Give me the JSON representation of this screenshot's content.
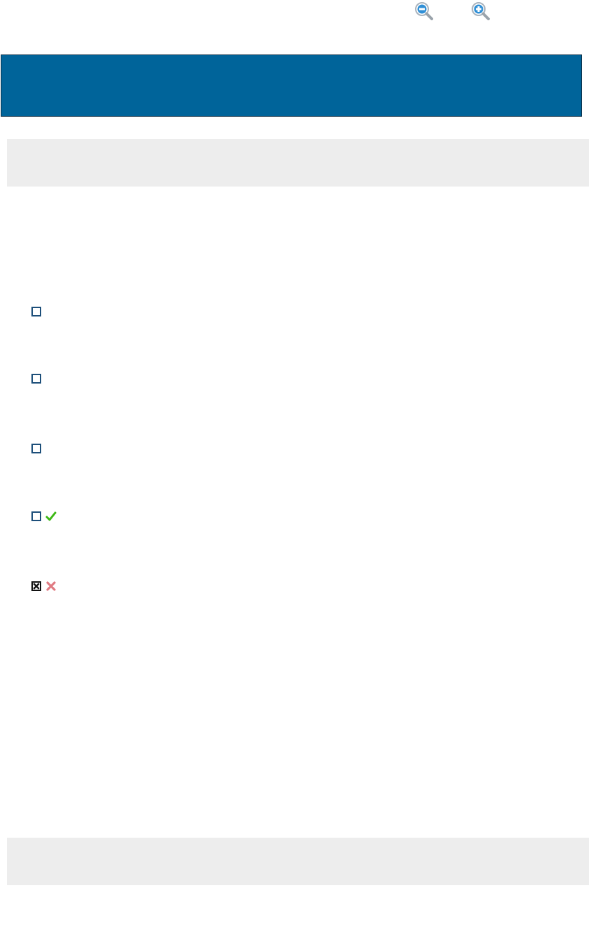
{
  "colors": {
    "banner_bg": "#00649A",
    "bar_bg": "#EDEDED",
    "checkbox_border": "#1D4F7A",
    "correct": "#3DB814",
    "incorrect": "#E07A82",
    "zoom_icon": "#2F8FD6"
  },
  "toolbar": {
    "zoom_out_icon": "zoom-out-icon",
    "zoom_in_icon": "zoom-in-icon"
  },
  "banner": {
    "title": ""
  },
  "top_bar": {
    "text": ""
  },
  "bottom_bar": {
    "text": ""
  },
  "options": [
    {
      "label": "",
      "checked": false,
      "mark": "none"
    },
    {
      "label": "",
      "checked": false,
      "mark": "none"
    },
    {
      "label": "",
      "checked": false,
      "mark": "none"
    },
    {
      "label": "",
      "checked": false,
      "mark": "check-icon"
    },
    {
      "label": "",
      "checked": true,
      "mark": "cross-icon"
    }
  ]
}
